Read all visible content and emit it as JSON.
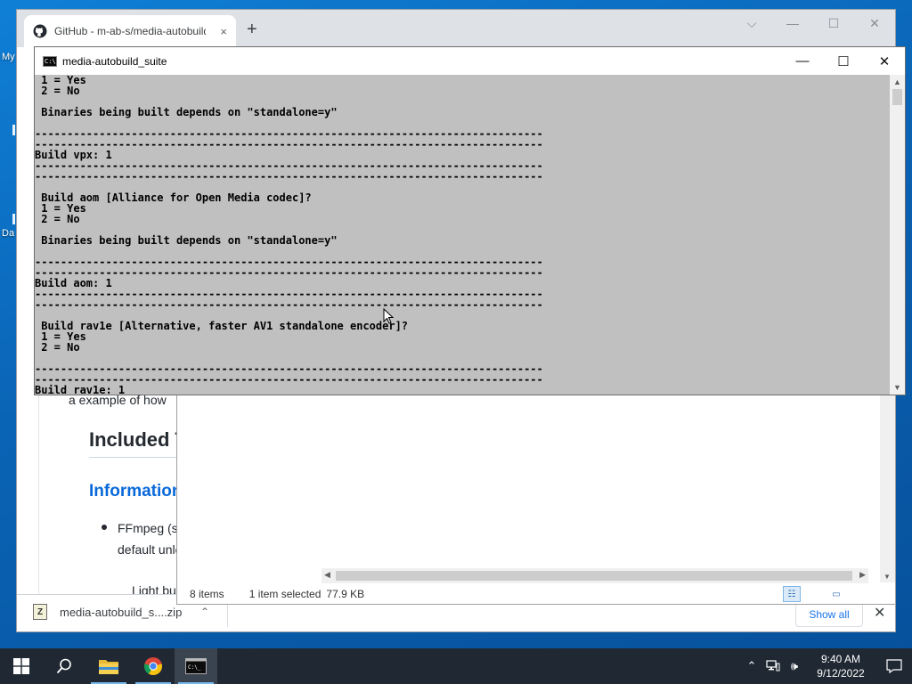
{
  "desktop": {
    "icon_labels": [
      "My",
      "Da"
    ]
  },
  "browser": {
    "tab_title": "GitHub - m-ab-s/media-autobuild_suite",
    "tab_close": "×",
    "new_tab": "+",
    "controls": {
      "dropdown": "⌵",
      "minimize": "—",
      "maximize": "☐",
      "close": "✕"
    },
    "page": {
      "cut_text": "a example of how",
      "heading_included": "Included To",
      "heading_info": "Information a",
      "bullet_line1": "FFmpeg (sha",
      "bullet_line2": "default unles",
      "sub_bullet": "Light bu"
    },
    "download_bar": {
      "file_name": "media-autobuild_s....zip",
      "chevron": "⌃",
      "show_all": "Show all",
      "close": "✕"
    }
  },
  "explorer": {
    "status": {
      "item_count": "8 items",
      "selected": "1 item selected",
      "size": "77.9 KB"
    }
  },
  "console": {
    "title": "media-autobuild_suite",
    "controls": {
      "minimize": "—",
      "maximize": "☐",
      "close": "✕"
    },
    "lines": [
      " 1 = Yes",
      " 2 = No",
      "",
      " Binaries being built depends on \"standalone=y\"",
      "",
      "-------------------------------------------------------------------------------",
      "-------------------------------------------------------------------------------",
      "Build vpx: 1",
      "-------------------------------------------------------------------------------",
      "-------------------------------------------------------------------------------",
      "",
      " Build aom [Alliance for Open Media codec]?",
      " 1 = Yes",
      " 2 = No",
      "",
      " Binaries being built depends on \"standalone=y\"",
      "",
      "-------------------------------------------------------------------------------",
      "-------------------------------------------------------------------------------",
      "Build aom: 1",
      "-------------------------------------------------------------------------------",
      "-------------------------------------------------------------------------------",
      "",
      " Build rav1e [Alternative, faster AV1 standalone encoder]?",
      " 1 = Yes",
      " 2 = No",
      "",
      "-------------------------------------------------------------------------------",
      "-------------------------------------------------------------------------------",
      "Build rav1e: 1_"
    ]
  },
  "taskbar": {
    "clock_time": "9:40 AM",
    "clock_date": "9/12/2022",
    "icons": [
      "windows-start-icon",
      "search-icon",
      "file-explorer-icon",
      "chrome-icon",
      "command-prompt-icon"
    ]
  }
}
